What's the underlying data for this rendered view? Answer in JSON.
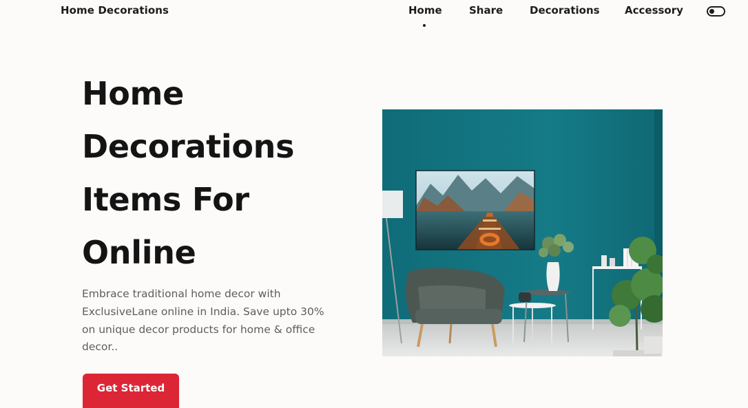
{
  "header": {
    "brand": "Home Decorations",
    "nav": [
      {
        "label": "Home",
        "active": true
      },
      {
        "label": "Share",
        "active": false
      },
      {
        "label": "Decorations",
        "active": false
      },
      {
        "label": "Accessory",
        "active": false
      }
    ],
    "theme_toggle_icon": "toggle-icon"
  },
  "hero": {
    "title_lines": [
      "Home",
      "Decorations",
      "Items For",
      "Online"
    ],
    "description": "Embrace traditional home decor with ExclusiveLane online in India. Save upto 30% on unique decor products for home & office decor..",
    "cta_label": "Get Started",
    "image_icon": "living-room-photo"
  },
  "colors": {
    "background": "#fcfbf9",
    "text": "#141414",
    "muted": "#5d5d5d",
    "accent": "#dc2636",
    "wall_teal": "#137480"
  }
}
